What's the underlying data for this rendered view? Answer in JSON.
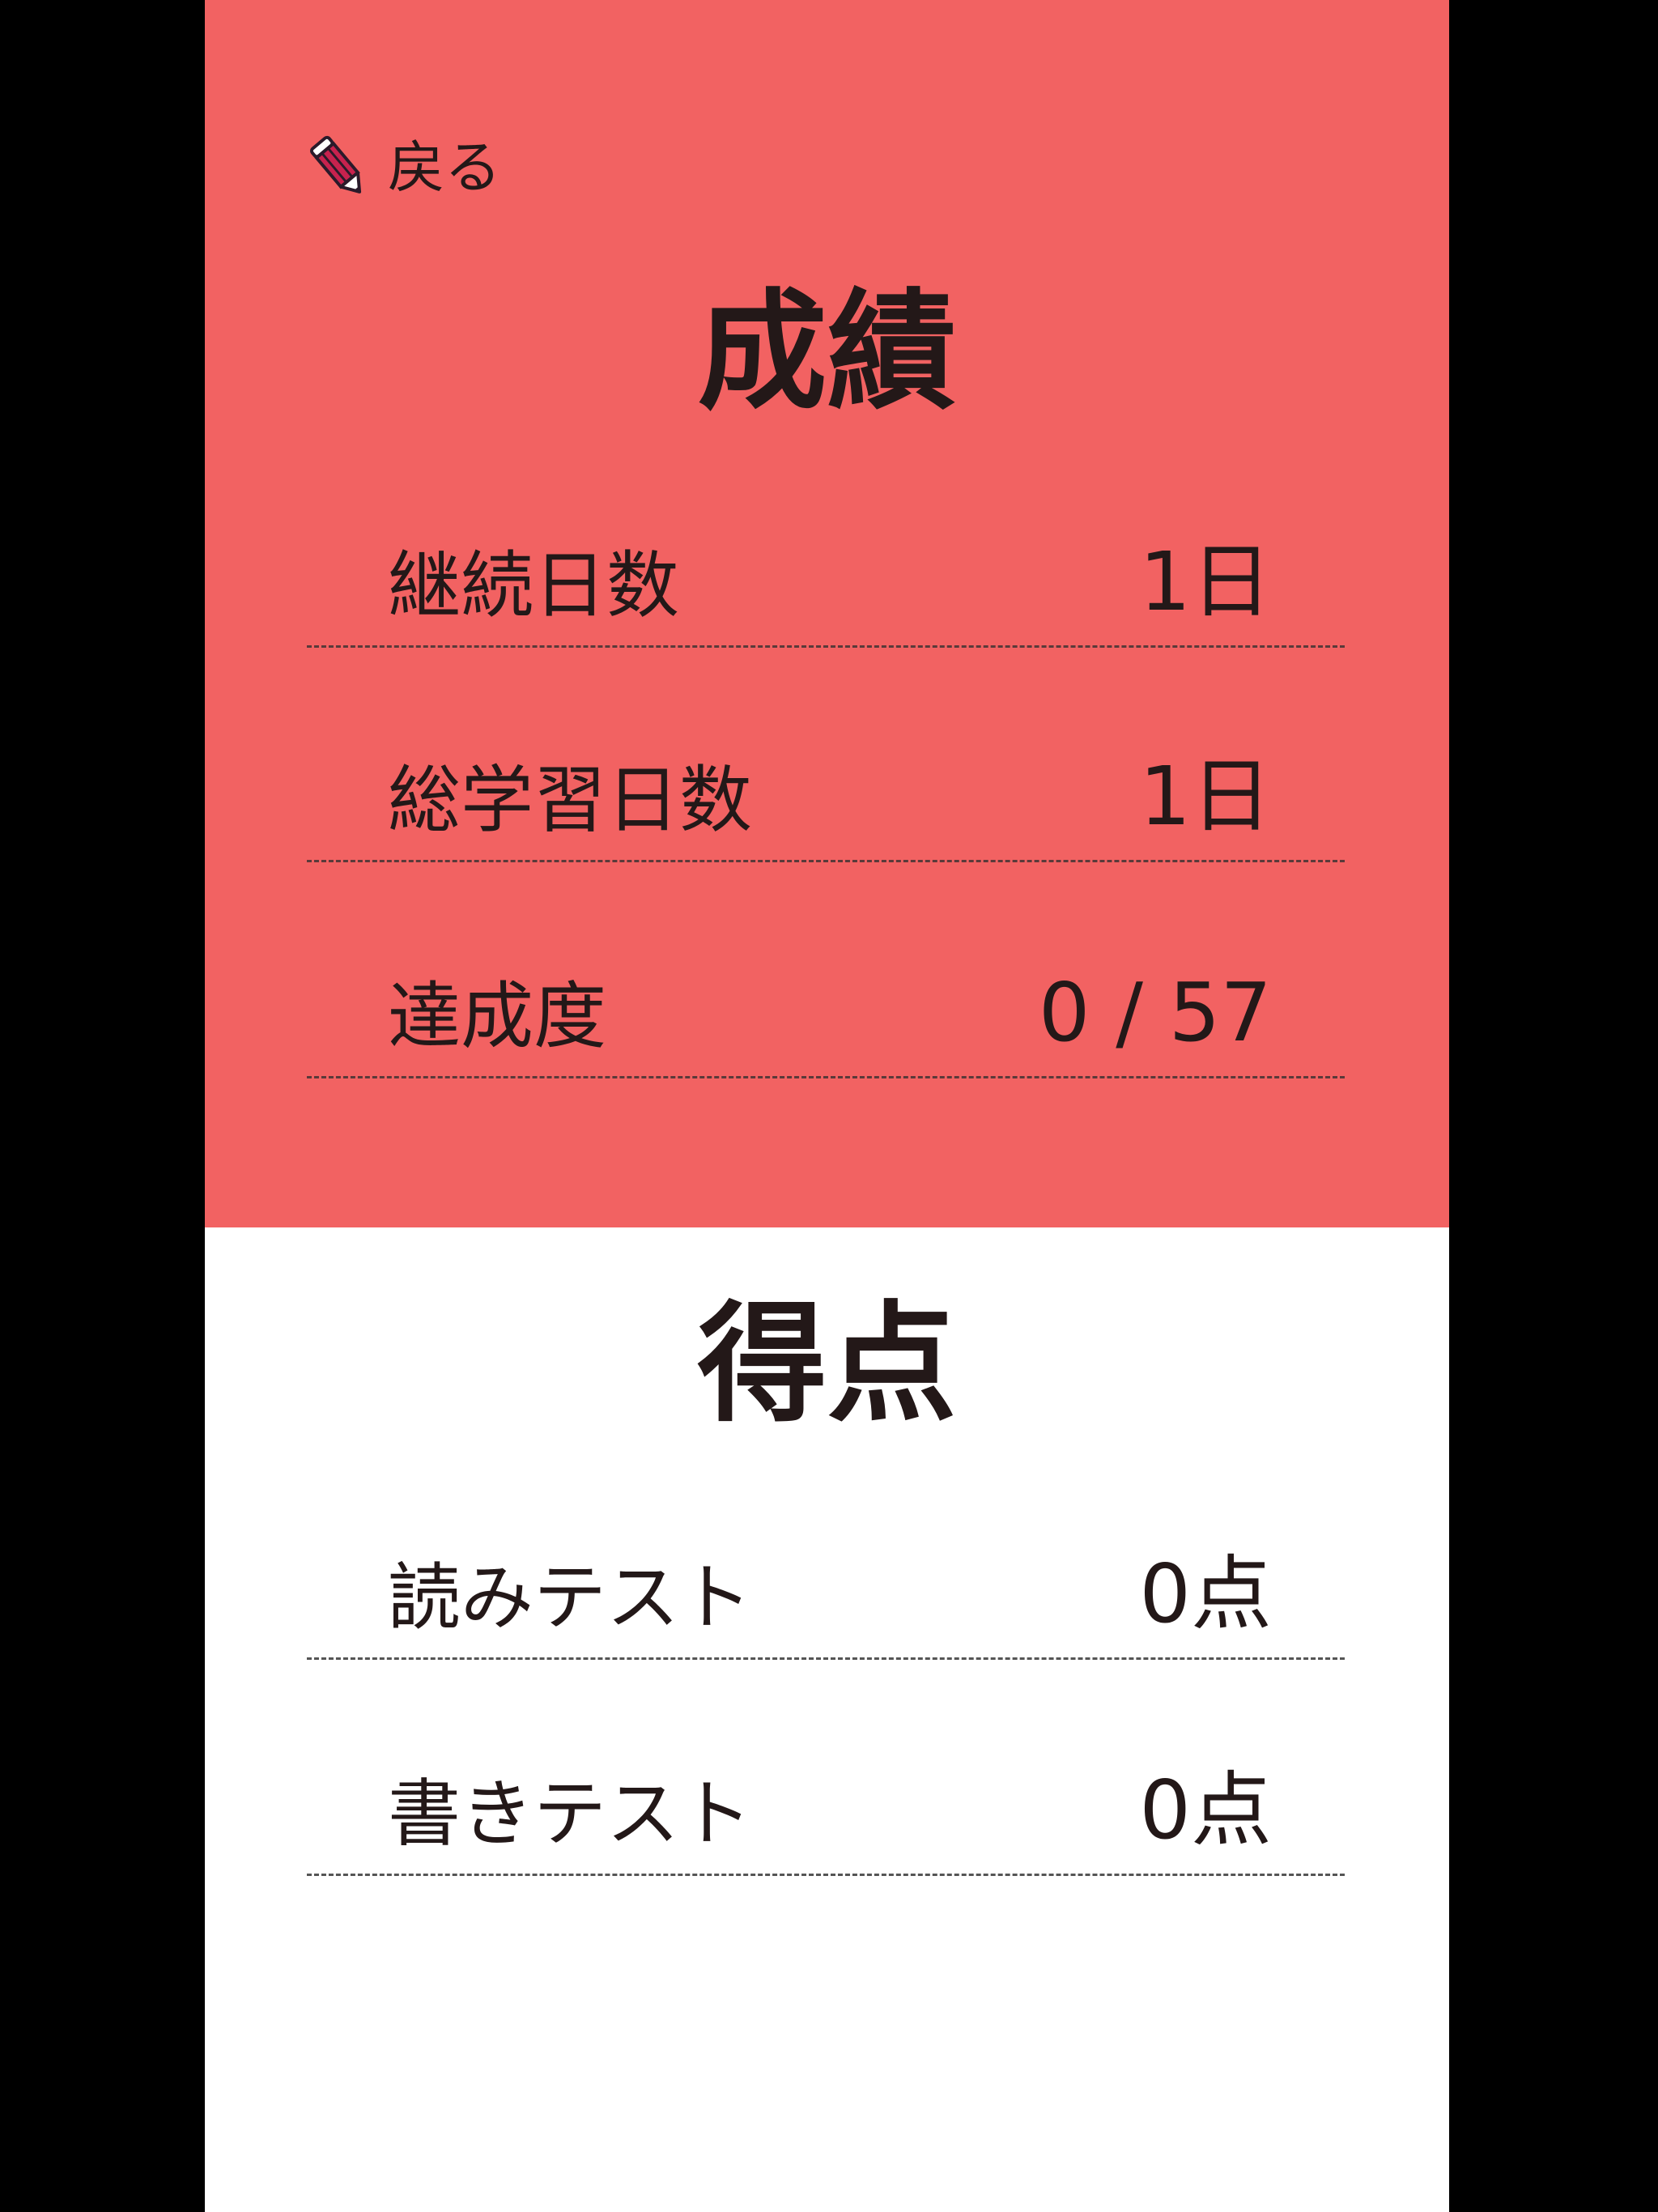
{
  "header": {
    "back_label": "戻る"
  },
  "record": {
    "title": "成績",
    "rows": [
      {
        "label": "継続日数",
        "value": "1日"
      },
      {
        "label": "総学習日数",
        "value": "1日"
      },
      {
        "label": "達成度",
        "value": "0 / 57"
      }
    ]
  },
  "score": {
    "title": "得点",
    "rows": [
      {
        "label": "読みテスト",
        "value": "0点"
      },
      {
        "label": "書きテスト",
        "value": "0点"
      }
    ]
  },
  "colors": {
    "top_background": "#f26262",
    "bottom_background": "#ffffff",
    "text": "#231818"
  },
  "icons": {
    "back": "pencil-icon"
  }
}
